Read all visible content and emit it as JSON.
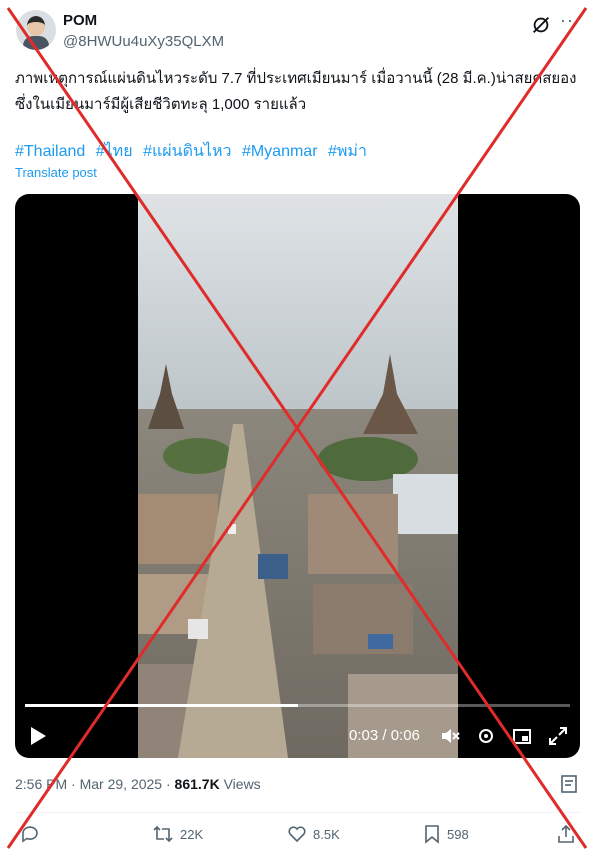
{
  "author": {
    "name": "POM",
    "handle": "@8HWUu4uXy35QLXM"
  },
  "post": {
    "text": "ภาพเหตุการณ์แผ่นดินไหวระดับ 7.7 ที่ประเทศเมียนมาร์ เมื่อวานนี้ (28 มี.ค.)น่าสยดสยอง ซึ่งในเมียนมาร์มีผู้เสียชีวิตทะลุ 1,000 รายแล้ว",
    "hashtags": [
      "#Thailand",
      "#ไทย",
      "#แผ่นดินไหว",
      "#Myanmar",
      "#พม่า"
    ],
    "translate_label": "Translate post"
  },
  "video": {
    "time": "0:03 / 0:06",
    "progress": 0.5
  },
  "meta": {
    "time": "2:56 PM",
    "separator": "·",
    "date": "Mar 29, 2025",
    "views_count": "861.7K",
    "views_label": "Views"
  },
  "actions": {
    "retweets": "22K",
    "likes": "8.5K",
    "bookmarks": "598"
  },
  "colors": {
    "link": "#1d9bf0",
    "muted": "#536471",
    "overlay_x": "#e02b2b"
  },
  "icons": [
    "grok-icon",
    "more-icon",
    "play-icon",
    "mute-icon",
    "settings-icon",
    "pip-icon",
    "fullscreen-icon",
    "analytics-icon",
    "reply-icon",
    "retweet-icon",
    "like-icon",
    "bookmark-icon",
    "share-icon"
  ]
}
